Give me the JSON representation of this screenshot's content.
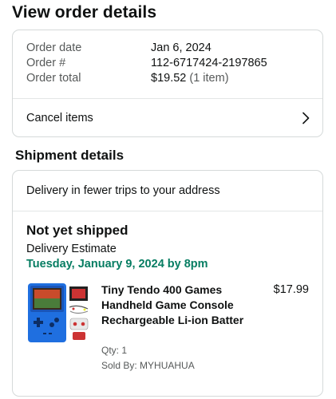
{
  "page": {
    "title": "View order details"
  },
  "order_summary": {
    "rows": [
      {
        "label": "Order date",
        "value": "Jan 6, 2024"
      },
      {
        "label": "Order #",
        "value": "112-6717424-2197865"
      },
      {
        "label": "Order total",
        "value": "$19.52",
        "value_suffix": "(1 item)"
      }
    ],
    "cancel_label": "Cancel items",
    "cancel_icon": "chevron-right-icon"
  },
  "shipment": {
    "section_title": "Shipment details",
    "delivery_note": "Delivery in fewer trips to your address",
    "status": "Not yet shipped",
    "estimate_label": "Delivery Estimate",
    "estimate_date": "Tuesday, January 9, 2024 by 8pm",
    "estimate_color": "#067d62"
  },
  "product": {
    "title": "Tiny Tendo 400 Games Handheld Game Console Rechargeable Li-ion Batter",
    "price": "$17.99",
    "qty": "Qty: 1",
    "seller": "Sold By: MYHUAHUA",
    "image": "handheld-game-console-image",
    "accent_color": "#1f6fe0"
  }
}
